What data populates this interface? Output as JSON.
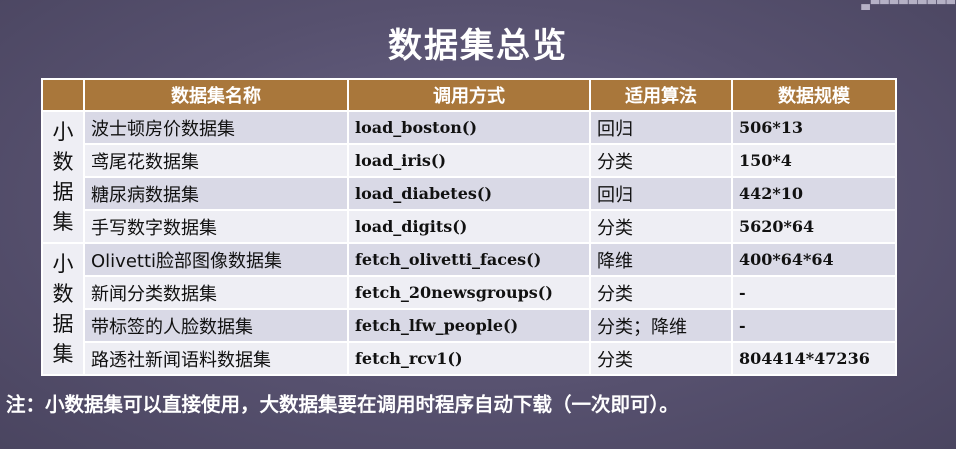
{
  "title": "数据集总览",
  "headers": [
    "数据集名称",
    "调用方式",
    "适用算法",
    "数据规模"
  ],
  "groups": [
    {
      "label": "小数据集",
      "rows": [
        {
          "name": "波士顿房价数据集",
          "call": "load_boston()",
          "algo": "回归",
          "size": "506*13"
        },
        {
          "name": "鸢尾花数据集",
          "call": "load_iris()",
          "algo": "分类",
          "size": "150*4"
        },
        {
          "name": "糖尿病数据集",
          "call": "load_diabetes()",
          "algo": "回归",
          "size": "442*10"
        },
        {
          "name": "手写数字数据集",
          "call": "load_digits()",
          "algo": "分类",
          "size": "5620*64"
        }
      ]
    },
    {
      "label": "小数据集",
      "rows": [
        {
          "name": "Olivetti脸部图像数据集",
          "call": "fetch_olivetti_faces()",
          "algo": "降维",
          "size": "400*64*64"
        },
        {
          "name": "新闻分类数据集",
          "call": "fetch_20newsgroups()",
          "algo": "分类",
          "size": "-"
        },
        {
          "name": "带标签的人脸数据集",
          "call": "fetch_lfw_people()",
          "algo": "分类；降维",
          "size": "-"
        },
        {
          "name": "路透社新闻语料数据集",
          "call": "fetch_rcv1()",
          "algo": "分类",
          "size": "804414*47236"
        }
      ]
    }
  ],
  "note": "注：小数据集可以直接使用，大数据集要在调用时程序自动下载（一次即可）。"
}
